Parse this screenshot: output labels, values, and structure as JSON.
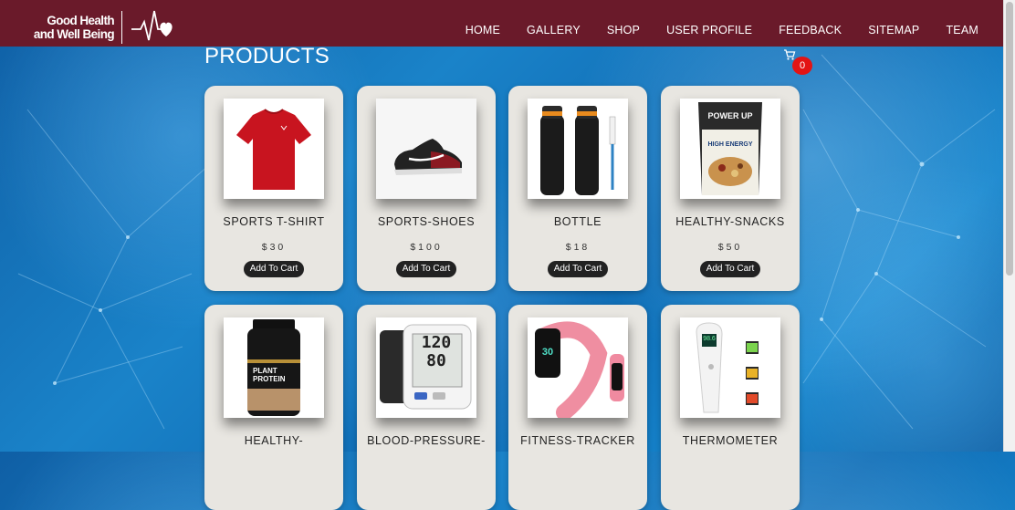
{
  "header": {
    "logo_text": "Good Health and Well Being",
    "nav": [
      "HOME",
      "GALLERY",
      "SHOP",
      "USER PROFILE",
      "FEEDBACK",
      "SITEMAP",
      "TEAM"
    ]
  },
  "page": {
    "title": "PRODUCTS",
    "cart_count": "0"
  },
  "products": [
    {
      "name": "SPORTS T-SHIRT",
      "price": "$30",
      "button": "Add To Cart",
      "icon": "tshirt-image"
    },
    {
      "name": "SPORTS-SHOES",
      "price": "$100",
      "button": "Add To Cart",
      "icon": "shoes-image"
    },
    {
      "name": "BOTTLE",
      "price": "$18",
      "button": "Add To Cart",
      "icon": "bottle-image"
    },
    {
      "name": "HEALTHY-SNACKS",
      "price": "$50",
      "button": "Add To Cart",
      "icon": "snacks-image"
    },
    {
      "name": "HEALTHY-",
      "icon": "protein-image"
    },
    {
      "name": "BLOOD-PRESSURE-",
      "icon": "bp-monitor-image"
    },
    {
      "name": "FITNESS-TRACKER",
      "icon": "fitness-tracker-image"
    },
    {
      "name": "THERMOMETER",
      "icon": "thermometer-image"
    }
  ],
  "product_images_text": {
    "snack_brand": "POWER UP",
    "snack_label": "HIGH ENERGY",
    "protein_label": "PLANT PROTEIN",
    "bp_reading_1": "120",
    "bp_reading_2": "80",
    "tracker_reading": "30",
    "thermo_reading": "98.6"
  },
  "colors": {
    "header": "#6a1a2a",
    "card": "#e8e6e1",
    "badge": "#e31414",
    "button": "#222222"
  }
}
